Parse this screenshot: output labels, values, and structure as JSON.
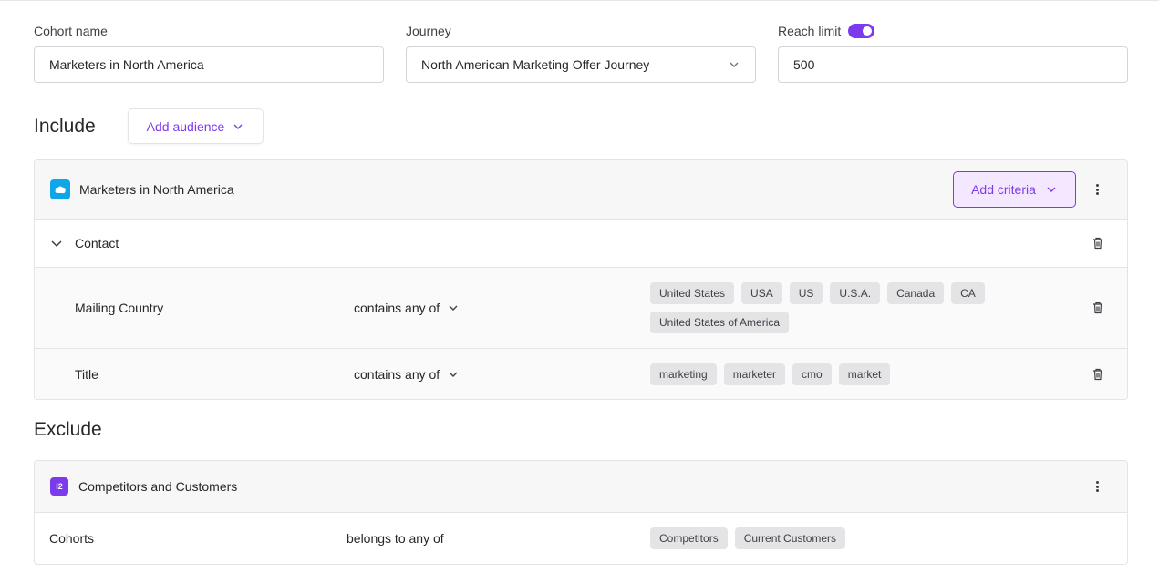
{
  "form": {
    "cohort_name": {
      "label": "Cohort name",
      "value": "Marketers in North America"
    },
    "journey": {
      "label": "Journey",
      "value": "North American Marketing Offer Journey"
    },
    "reach_limit": {
      "label": "Reach limit",
      "value": "500",
      "enabled": true
    }
  },
  "include": {
    "title": "Include",
    "add_audience_label": "Add audience",
    "audience": {
      "name": "Marketers in North America",
      "source_icon": "salesforce-icon",
      "add_criteria_label": "Add criteria",
      "group": {
        "label": "Contact",
        "criteria": [
          {
            "field": "Mailing Country",
            "operator": "contains any of",
            "values": [
              "United States",
              "USA",
              "US",
              "U.S.A.",
              "Canada",
              "CA",
              "United States of America"
            ]
          },
          {
            "field": "Title",
            "operator": "contains any of",
            "values": [
              "marketing",
              "marketer",
              "cmo",
              "market"
            ]
          }
        ]
      }
    }
  },
  "exclude": {
    "title": "Exclude",
    "audience": {
      "name": "Competitors and Customers",
      "badge": "I2",
      "criteria": {
        "field": "Cohorts",
        "operator": "belongs to any of",
        "values": [
          "Competitors",
          "Current Customers"
        ]
      }
    }
  },
  "colors": {
    "accent": "#7c3aed",
    "chip_bg": "#e4e4e7",
    "salesforce": "#0ea5e9"
  }
}
